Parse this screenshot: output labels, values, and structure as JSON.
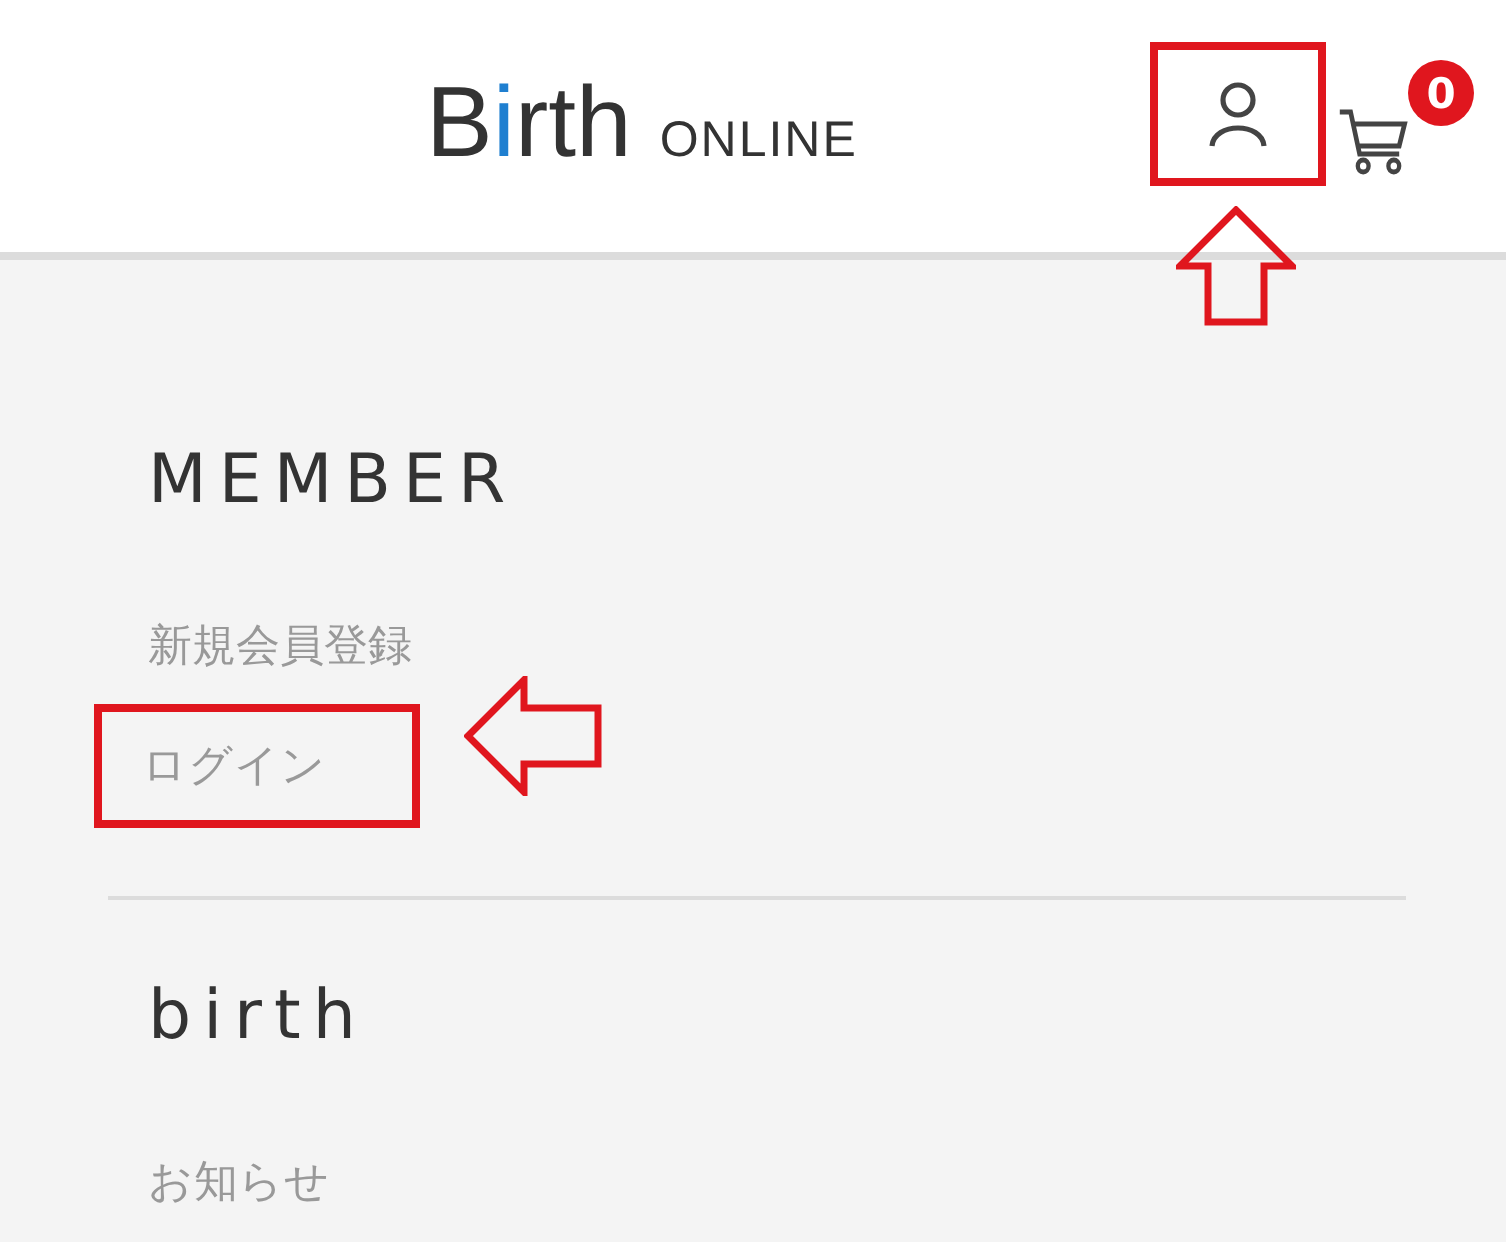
{
  "header": {
    "logo": [
      {
        "text": "B",
        "accent": false
      },
      {
        "text": "i",
        "accent": true
      },
      {
        "text": "rth",
        "accent": false
      }
    ],
    "logo_suffix": "ONLINE",
    "account_button": {
      "highlighted": true
    },
    "cart": {
      "count": "0"
    }
  },
  "sections": [
    {
      "title": "MEMBER",
      "links": [
        {
          "label": "新規会員登録",
          "highlighted": false
        },
        {
          "label": "ログイン",
          "highlighted": true
        }
      ]
    },
    {
      "title": "birth",
      "links": [
        {
          "label": "お知らせ",
          "highlighted": false
        }
      ]
    }
  ]
}
